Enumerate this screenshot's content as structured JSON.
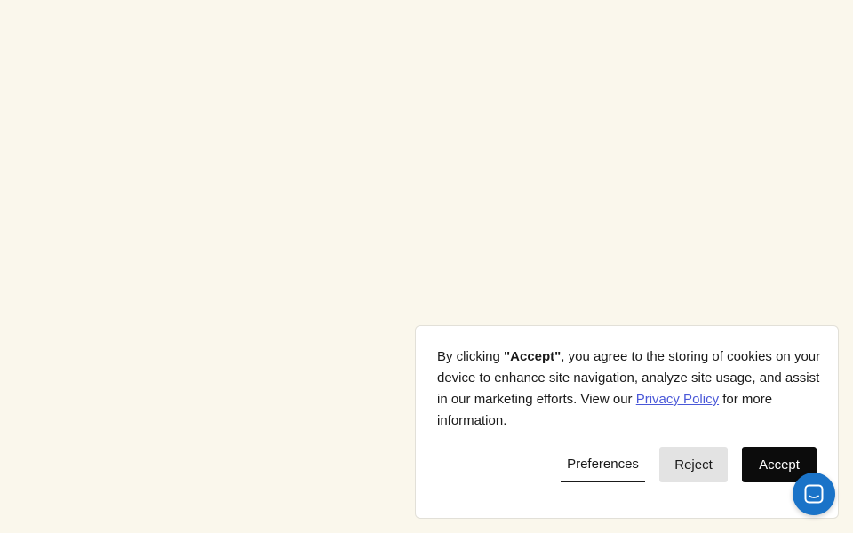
{
  "cookie_banner": {
    "text_prefix": "By clicking ",
    "text_strong": "\"Accept\"",
    "text_middle": ", you agree to the storing of cookies on your device to enhance site navigation, analyze site usage, and assist in our marketing efforts. View our ",
    "privacy_link": "Privacy Policy",
    "text_suffix": " for more information.",
    "buttons": {
      "preferences": "Preferences",
      "reject": "Reject",
      "accept": "Accept"
    }
  },
  "chat_launcher": {
    "icon": "chat-bubble-icon"
  },
  "colors": {
    "page_background": "#faf7ec",
    "link": "#4a58d8",
    "accept_background": "#0c0c0c",
    "reject_background": "#e3e3e3",
    "chat_launcher": "#1a73c8"
  }
}
